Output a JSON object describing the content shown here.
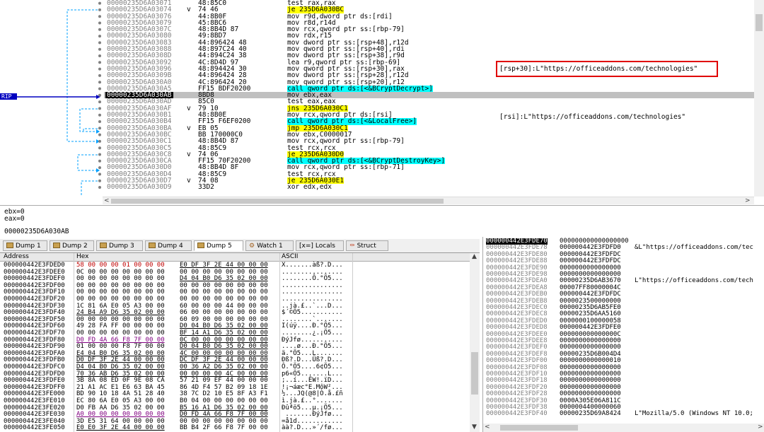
{
  "disasm": {
    "rows": [
      {
        "addr": "00000235D6A03071",
        "bytes": "48:85C0",
        "instr": "test rax,rax"
      },
      {
        "addr": "00000235D6A03074",
        "bytes": "74 46",
        "arrow": "v",
        "instr": "je 235D6A030BC",
        "hl": "yel"
      },
      {
        "addr": "00000235D6A03076",
        "bytes": "44:8B0F",
        "instr": "mov r9d,dword ptr ds:[rdi]"
      },
      {
        "addr": "00000235D6A03079",
        "bytes": "45:8BC6",
        "instr": "mov r8d,r14d"
      },
      {
        "addr": "00000235D6A0307C",
        "bytes": "48:8B4D 87",
        "instr": "mov rcx,qword ptr ss:[rbp-79]"
      },
      {
        "addr": "00000235D6A03080",
        "bytes": "49:8BD7",
        "instr": "mov rdx,r15"
      },
      {
        "addr": "00000235D6A03083",
        "bytes": "44:896424 48",
        "instr": "mov dword ptr ss:[rsp+48],r12d"
      },
      {
        "addr": "00000235D6A03088",
        "bytes": "48:897C24 40",
        "instr": "mov qword ptr ss:[rsp+40],rdi"
      },
      {
        "addr": "00000235D6A0308D",
        "bytes": "44:894C24 38",
        "instr": "mov dword ptr ss:[rsp+38],r9d"
      },
      {
        "addr": "00000235D6A03092",
        "bytes": "4C:8D4D 97",
        "instr": "lea r9,qword ptr ss:[rbp-69]"
      },
      {
        "addr": "00000235D6A03096",
        "bytes": "48:894424 30",
        "instr": "mov qword ptr ss:[rsp+30],rax"
      },
      {
        "addr": "00000235D6A0309B",
        "bytes": "44:896424 28",
        "instr": "mov dword ptr ss:[rsp+28],r12d"
      },
      {
        "addr": "00000235D6A030A0",
        "bytes": "4C:896424 20",
        "instr": "mov qword ptr ss:[rsp+20],r12"
      },
      {
        "addr": "00000235D6A030A5",
        "bytes": "FF15 BDF20200",
        "instr": "call qword ptr ds:[<&BCryptDecrypt>]",
        "hl": "cyan"
      },
      {
        "addr": "00000235D6A030AB",
        "bytes": "8BD8",
        "instr": "mov ebx,eax",
        "cur": true
      },
      {
        "addr": "00000235D6A030AD",
        "bytes": "85C0",
        "instr": "test eax,eax"
      },
      {
        "addr": "00000235D6A030AF",
        "bytes": "79 10",
        "arrow": "v",
        "instr": "jns 235D6A030C1",
        "hl": "yel"
      },
      {
        "addr": "00000235D6A030B1",
        "bytes": "48:8B0E",
        "instr": "mov rcx,qword ptr ds:[rsi]"
      },
      {
        "addr": "00000235D6A030B4",
        "bytes": "FF15 F6EF0200",
        "instr": "call qword ptr ds:[<&LocalFree>]",
        "hl": "cyan"
      },
      {
        "addr": "00000235D6A030BA",
        "bytes": "EB 05",
        "arrow": "v",
        "instr": "jmp 235D6A030C1",
        "hl": "yel"
      },
      {
        "addr": "00000235D6A030BC",
        "bytes": "BB 170000C0",
        "instr": "mov ebx,C0000017"
      },
      {
        "addr": "00000235D6A030C1",
        "bytes": "48:8B4D 87",
        "instr": "mov rcx,qword ptr ss:[rbp-79]"
      },
      {
        "addr": "00000235D6A030C5",
        "bytes": "48:85C9",
        "instr": "test rcx,rcx"
      },
      {
        "addr": "00000235D6A030C8",
        "bytes": "74 06",
        "arrow": "v",
        "instr": "je 235D6A030D0",
        "hl": "yel"
      },
      {
        "addr": "00000235D6A030CA",
        "bytes": "FF15 70F20200",
        "instr": "call qword ptr ds:[<&BCryptDestroyKey>]",
        "hl": "cyan"
      },
      {
        "addr": "00000235D6A030D0",
        "bytes": "48:8B4D 8F",
        "instr": "mov rcx,qword ptr ss:[rbp-71]"
      },
      {
        "addr": "00000235D6A030D4",
        "bytes": "48:85C9",
        "instr": "test rcx,rcx"
      },
      {
        "addr": "00000235D6A030D7",
        "bytes": "74 08",
        "arrow": "v",
        "instr": "je 235D6A030E1",
        "hl": "yel"
      },
      {
        "addr": "00000235D6A030D9",
        "bytes": "33D2",
        "instr": "xor edx,edx"
      }
    ],
    "comment_highlighted": "[rsp+30]:L\"https://officeaddons.com/technologies\"",
    "comment_rsi": "[rsi]:L\"https://officeaddons.com/technologies\"",
    "rip_label": "RIP"
  },
  "info": {
    "line1": "ebx=0",
    "line2": "eax=0",
    "line3": "00000235D6A030AB"
  },
  "tabs": [
    "Dump 1",
    "Dump 2",
    "Dump 3",
    "Dump 4",
    "Dump 5",
    "Watch 1",
    "Locals",
    "Struct"
  ],
  "active_tab": "Dump 5",
  "dump": {
    "col_address": "Address",
    "col_hex": "Hex",
    "col_ascii": "ASCII",
    "rows": [
      {
        "a": "000000442E3FDED0",
        "h1": "58 00 00 00 01 00 00 00",
        "h2": "E0 DF 3F 2E 44 00 00 00",
        "s": "X.......àß?.D..."
      },
      {
        "a": "000000442E3FDEE0",
        "h1": "0C 00 00 00 00 00 00 00",
        "h2": "00 00 00 00 00 00 00 00",
        "s": "................"
      },
      {
        "a": "000000442E3FDEF0",
        "h1": "00 00 00 00 00 00 00 00",
        "h2": "D4 04 B0 D6 35 02 00 00",
        "s": "........Ô.°Ö5..."
      },
      {
        "a": "000000442E3FDF00",
        "h1": "00 00 00 00 00 00 00 00",
        "h2": "00 00 00 00 00 00 00 00",
        "s": "................"
      },
      {
        "a": "000000442E3FDF10",
        "h1": "00 00 00 00 00 00 00 00",
        "h2": "00 00 00 00 00 00 00 00",
        "s": "................"
      },
      {
        "a": "000000442E3FDF20",
        "h1": "00 00 00 00 00 00 00 00",
        "h2": "00 00 00 00 00 00 00 00",
        "s": "................"
      },
      {
        "a": "000000442E3FDF30",
        "h1": "1C 81 6A E0 05 A3 00 00",
        "h2": "60 00 00 00 44 00 00 00",
        "s": "..jà.£..`...D..."
      },
      {
        "a": "000000442E3FDF40",
        "h1": "24 B4 A9 D6 35 02 00 00",
        "h2": "06 00 00 00 00 00 00 00",
        "s": "$´©Ö5..........."
      },
      {
        "a": "000000442E3FDF50",
        "h1": "00 00 00 00 00 00 00 00",
        "h2": "60 09 00 00 00 00 00 00",
        "s": "........`......."
      },
      {
        "a": "000000442E3FDF60",
        "h1": "49 28 FA FF 00 00 00 00",
        "h2": "D0 04 B0 D6 35 02 00 00",
        "s": "I(úÿ....Ð.°Ö5..."
      },
      {
        "a": "000000442E3FDF70",
        "h1": "00 00 00 00 00 00 00 00",
        "h2": "BF 14 A1 D6 35 02 00 00",
        "s": "........¿.¡Ö5..."
      },
      {
        "a": "000000442E3FDF80",
        "h1": "D0 FD 4A 66 F8 7F 00 00",
        "h2": "0C 00 00 00 00 00 00 00",
        "s": "ÐýJfø..........."
      },
      {
        "a": "000000442E3FDF90",
        "h1": "01 00 00 00 F8 7F 00 00",
        "h2": "D0 04 B0 D6 35 02 00 00",
        "s": "....ø...Ð.°Ö5..."
      },
      {
        "a": "000000442E3FDFA0",
        "h1": "E4 04 B0 D6 35 02 00 00",
        "h2": "4C 00 00 00 00 00 00 00",
        "s": "ä.°Ö5...L......."
      },
      {
        "a": "000000442E3FDFB0",
        "h1": "D0 DF 3F 2E 44 00 00 00",
        "h2": "DC DF 3F 2E 44 00 00 00",
        "s": "Ðß?.D...Üß?.D..."
      },
      {
        "a": "000000442E3FDFC0",
        "h1": "D4 04 B0 D6 35 02 00 00",
        "h2": "00 36 A2 D6 35 02 00 00",
        "s": "Ô.°Ö5....6¢Ö5..."
      },
      {
        "a": "000000442E3FDFD0",
        "h1": "70 36 AB D6 35 02 00 00",
        "h2": "00 00 00 00 4C 00 00 00",
        "s": "p6«Ö5.......L..."
      },
      {
        "a": "000000442E3FDFE0",
        "h1": "3B 8A 08 ED 0F 9E 08 CA",
        "h2": "57 21 09 EF 44 00 00 00",
        "s": ";..í...ÊW!.ïD..."
      },
      {
        "a": "000000442E3FDFF0",
        "h1": "21 A1 AC E1 E6 63 BA 45",
        "h2": "86 4D F4 57 B2 09 18 1E",
        "s": "!¡¬áæc°E.MôW²..."
      },
      {
        "a": "000000442E3FE000",
        "h1": "BD 90 10 18 4A 51 28 40",
        "h2": "38 7C D2 10 E5 8F A3 F1",
        "s": "½...JQ(@8|Ò.å.£ñ"
      },
      {
        "a": "000000442E3FE010",
        "h1": "EC 80 6A E0 05 A3 00 00",
        "h2": "B0 04 00 00 00 00 00 00",
        "s": "ì.jà.£..°......."
      },
      {
        "a": "000000442E3FE020",
        "h1": "D0 FB AA D6 35 02 00 00",
        "h2": "B5 16 A1 D6 35 02 00 00",
        "s": "Ðûªö5...µ.¡Ö5..."
      },
      {
        "a": "000000442E3FE030",
        "h1": "A0 00 00 00 00 00 00 00",
        "h2": "D0 FD 4A 66 F8 7F 00 00",
        "s": " .......ÐýJfø..."
      },
      {
        "a": "000000442E3FE040",
        "h1": "3D E5 31 64 00 00 00 00",
        "h2": "00 00 00 00 00 00 00 00",
        "s": "=å1d............"
      },
      {
        "a": "000000442E3FE050",
        "h1": "E0 E0 3F 2E 44 00 00 00",
        "h2": "BB B4 2F 66 F8 7F 00 00",
        "s": "àà?.D...»´/fø..."
      }
    ]
  },
  "stack": {
    "rows": [
      {
        "a": "000000442E3FDE70",
        "v": "000000000000000000",
        "c": "",
        "top": true
      },
      {
        "a": "000000442E3FDE78",
        "v": "000000442E3FDFD0",
        "c": "&L\"https://officeaddons.com/tec"
      },
      {
        "a": "000000442E3FDE80",
        "v": "000000442E3FDFDC",
        "c": ""
      },
      {
        "a": "000000442E3FDE88",
        "v": "000000442E3FDFDC",
        "c": ""
      },
      {
        "a": "000000442E3FDE90",
        "v": "0000000000000000",
        "c": ""
      },
      {
        "a": "000000442E3FDE98",
        "v": "0000000000000000",
        "c": ""
      },
      {
        "a": "000000442E3FDEA0",
        "v": "00000235D6AB3670",
        "c": "L\"https://officeaddons.com/tech"
      },
      {
        "a": "000000442E3FDEA8",
        "v": "00007FF80000004C",
        "c": ""
      },
      {
        "a": "000000442E3FDEB0",
        "v": "000000442E3FDFDC",
        "c": ""
      },
      {
        "a": "000000442E3FDEB8",
        "v": "0000023500000000",
        "c": ""
      },
      {
        "a": "000000442E3FDEC0",
        "v": "00000235D6AB5FE0",
        "c": ""
      },
      {
        "a": "000000442E3FDEC8",
        "v": "00000235D6AA5160",
        "c": ""
      },
      {
        "a": "000000442E3FDED0",
        "v": "0000000100000058",
        "c": ""
      },
      {
        "a": "000000442E3FDED8",
        "v": "000000442E3FDFE0",
        "c": ""
      },
      {
        "a": "000000442E3FDEE0",
        "v": "000000000000000C",
        "c": ""
      },
      {
        "a": "000000442E3FDEE8",
        "v": "0000000000000000",
        "c": ""
      },
      {
        "a": "000000442E3FDEF0",
        "v": "0000000000000000",
        "c": ""
      },
      {
        "a": "000000442E3FDEF8",
        "v": "00000235D6B004D4",
        "c": ""
      },
      {
        "a": "000000442E3FDF00",
        "v": "0000000000000010",
        "c": ""
      },
      {
        "a": "000000442E3FDF08",
        "v": "0000000000000000",
        "c": ""
      },
      {
        "a": "000000442E3FDF10",
        "v": "0000000000000000",
        "c": ""
      },
      {
        "a": "000000442E3FDF18",
        "v": "0000000000000000",
        "c": ""
      },
      {
        "a": "000000442E3FDF20",
        "v": "0000000000000000",
        "c": ""
      },
      {
        "a": "000000442E3FDF28",
        "v": "0000000000000000",
        "c": ""
      },
      {
        "a": "000000442E3FDF30",
        "v": "0000A305E06A811C",
        "c": ""
      },
      {
        "a": "000000442E3FDF38",
        "v": "0000004400000060",
        "c": ""
      },
      {
        "a": "000000442E3FDF40",
        "v": "00000235D69A8424",
        "c": "L\"Mozilla/5.0 (Windows NT 10.0;"
      }
    ]
  }
}
